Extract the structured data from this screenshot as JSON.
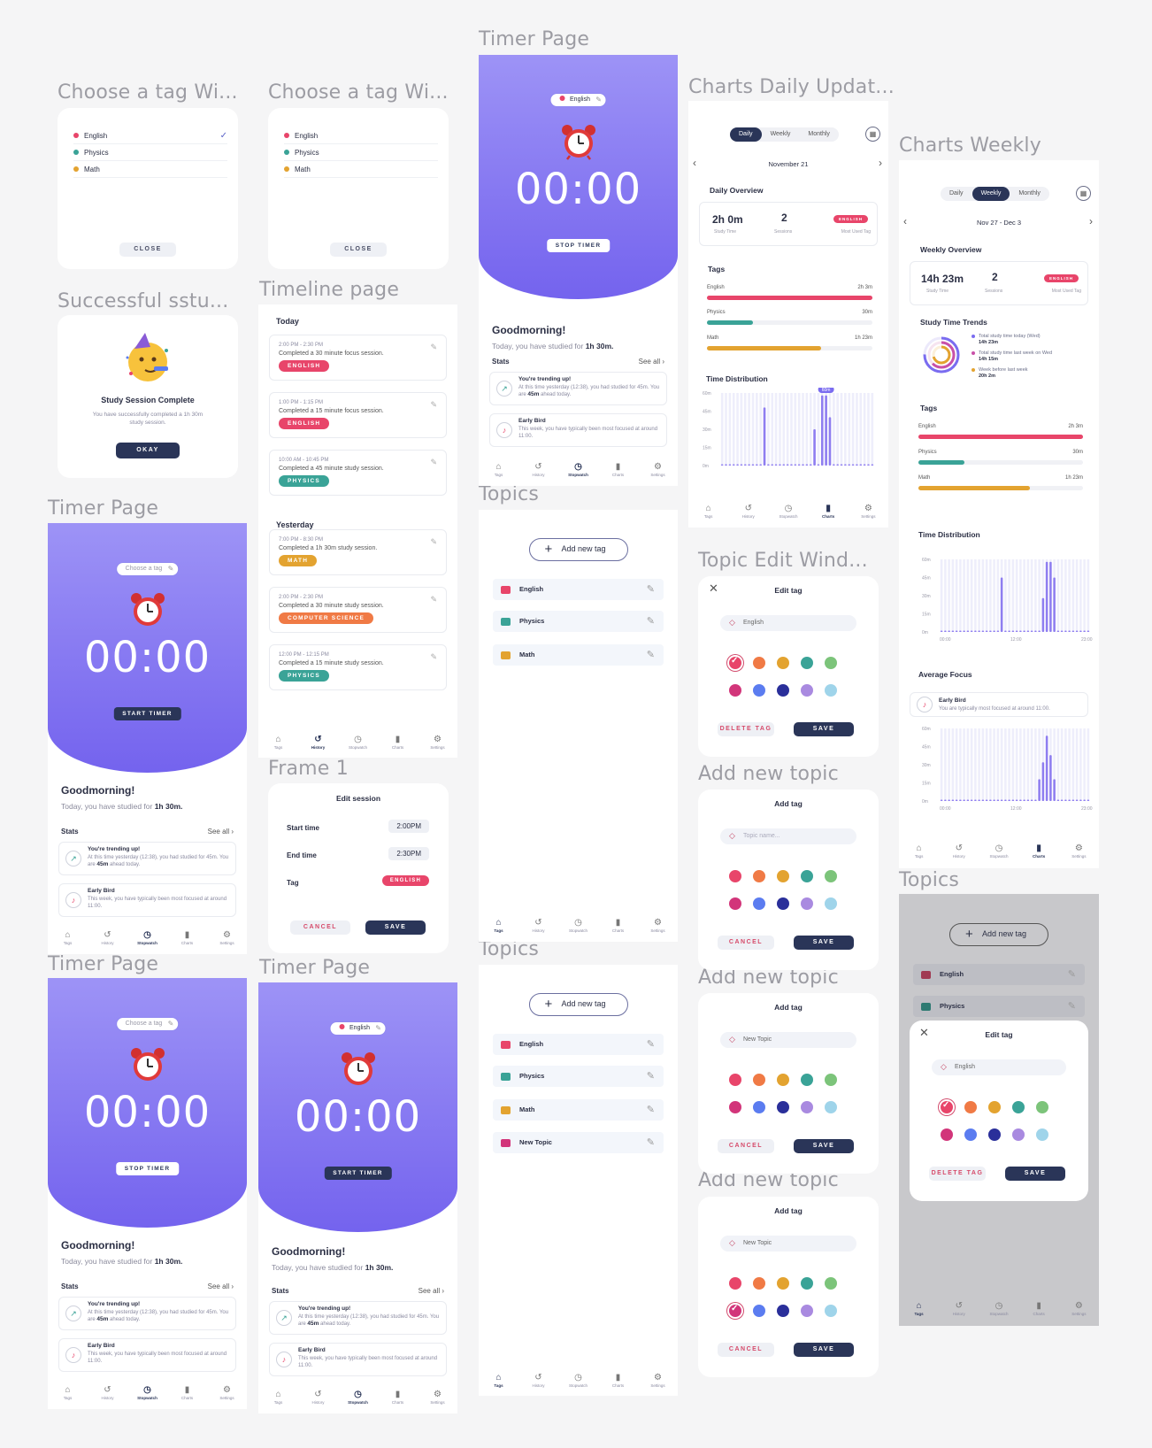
{
  "titles": {
    "tagModalA": "Choose a tag Wi...",
    "tagModalB": "Choose a tag Wi...",
    "success": "Successful sstu...",
    "timer1": "Timer Page",
    "timer2": "Timer Page",
    "timer3": "Timer Page",
    "timer4": "Timer Page",
    "timeline": "Timeline page",
    "frame1": "Frame 1",
    "topics1": "Topics",
    "topics2": "Topics",
    "topics3": "Topics",
    "chartsDaily": "Charts Daily Updat...",
    "chartsWeekly": "Charts Weekly",
    "topicEdit": "Topic Edit Wind...",
    "addTopic1": "Add new topic",
    "addTopic2": "Add new topic",
    "addTopic3": "Add new topic"
  },
  "tags": [
    {
      "name": "English",
      "color": "#e8456a"
    },
    {
      "name": "Physics",
      "color": "#3aa397"
    },
    {
      "name": "Math",
      "color": "#e3a330"
    }
  ],
  "close_label": "CLOSE",
  "success": {
    "heading": "Study Session Complete",
    "body": "You have successfully completed a 1h 30m study session.",
    "okay": "OKAY"
  },
  "timer": {
    "choose_tag": "Choose a tag",
    "selected_tag": "English",
    "time": "00:00",
    "start": "START TIMER",
    "stop": "STOP TIMER",
    "greeting": "Goodmorning!",
    "studied_prefix": "Today, you have studied for",
    "studied_value": "1h 30m.",
    "stats": "Stats",
    "see_all": "See all  ›",
    "trend_title": "You're trending up!",
    "trend_body_a": "At this time yesterday (12:38), you had studied for 45m. You are",
    "trend_bold": "45m",
    "trend_body_b": "ahead today.",
    "bird_title": "Early Bird",
    "bird_body": "This week, you have typically been most focused at around 11:00."
  },
  "nav": [
    "Tags",
    "History",
    "Stopwatch",
    "Charts",
    "Settings"
  ],
  "timeline": {
    "today": "Today",
    "yesterday": "Yesterday",
    "sessions": [
      {
        "time": "2:00 PM - 2:30 PM",
        "desc": "Completed a 30 minute focus session.",
        "tag": "ENGLISH",
        "color": "#e8456a"
      },
      {
        "time": "1:00 PM - 1:15 PM",
        "desc": "Completed a 15 minute focus session.",
        "tag": "ENGLISH",
        "color": "#e8456a"
      },
      {
        "time": "10:00 AM - 10:45 PM",
        "desc": "Completed a 45 minute study session.",
        "tag": "PHYSICS",
        "color": "#3aa397"
      },
      {
        "time": "7:00 PM - 8:30 PM",
        "desc": "Completed a 1h 30m study session.",
        "tag": "MATH",
        "color": "#e3a330"
      },
      {
        "time": "2:00 PM - 2:30 PM",
        "desc": "Completed a 30 minute study session.",
        "tag": "COMPUTER SCIENCE",
        "color": "#f07a45"
      },
      {
        "time": "12:00 PM - 12:15 PM",
        "desc": "Completed a 15 minute study session.",
        "tag": "PHYSICS",
        "color": "#3aa397"
      }
    ]
  },
  "edit_session": {
    "title": "Edit session",
    "start_label": "Start time",
    "start": "2:00PM",
    "end_label": "End time",
    "end": "2:30PM",
    "tag_label": "Tag",
    "tag": "ENGLISH",
    "cancel": "CANCEL",
    "save": "SAVE"
  },
  "topics": {
    "add": "Add new tag",
    "new_topic": "New Topic"
  },
  "edit_tag": {
    "title": "Edit tag",
    "add_title": "Add tag",
    "value": "English",
    "placeholder": "Topic name...",
    "new_value": "New Topic",
    "delete": "DELETE TAG",
    "cancel": "CANCEL",
    "save": "SAVE",
    "palette": [
      "#e8456a",
      "#f07a45",
      "#e3a330",
      "#3aa397",
      "#7cc47a",
      "#d2357a",
      "#5b7cf0",
      "#2a2f9a",
      "#a98ae0",
      "#9fd4ea"
    ]
  },
  "charts": {
    "tabs": [
      "Daily",
      "Weekly",
      "Monthly"
    ],
    "daily_date": "November 21",
    "weekly_date": "Nov 27 - Dec 3",
    "daily_overview": "Daily Overview",
    "weekly_overview": "Weekly Overview",
    "daily_study": "2h 0m",
    "weekly_study": "14h 23m",
    "sessions_val": "2",
    "study_time": "Study Time",
    "sessions": "Sessions",
    "most_used": "Most Used Tag",
    "most_tag": "ENGLISH",
    "tags_head": "Tags",
    "tag_times": [
      "2h 3m",
      "30m",
      "1h 23m"
    ],
    "time_dist": "Time Distribution",
    "trends": "Study Time Trends",
    "avg_focus": "Average Focus",
    "bubble": "60m",
    "y_ticks": [
      "60m",
      "45m",
      "30m",
      "15m",
      "0m"
    ],
    "x_ticks": [
      "00:00",
      "12:00",
      "23:00"
    ],
    "legend": [
      {
        "t": "Total study time today (Wed)",
        "v": "14h 23m",
        "c": "#7a6cf0"
      },
      {
        "t": "Total study time last week on Wed",
        "v": "14h 15m",
        "c": "#c850a8"
      },
      {
        "t": "Week before last week",
        "v": "20h 2m",
        "c": "#e3a330"
      }
    ],
    "bird_title": "Early Bird",
    "bird_body": "You are typically most focused at around 11:00."
  }
}
